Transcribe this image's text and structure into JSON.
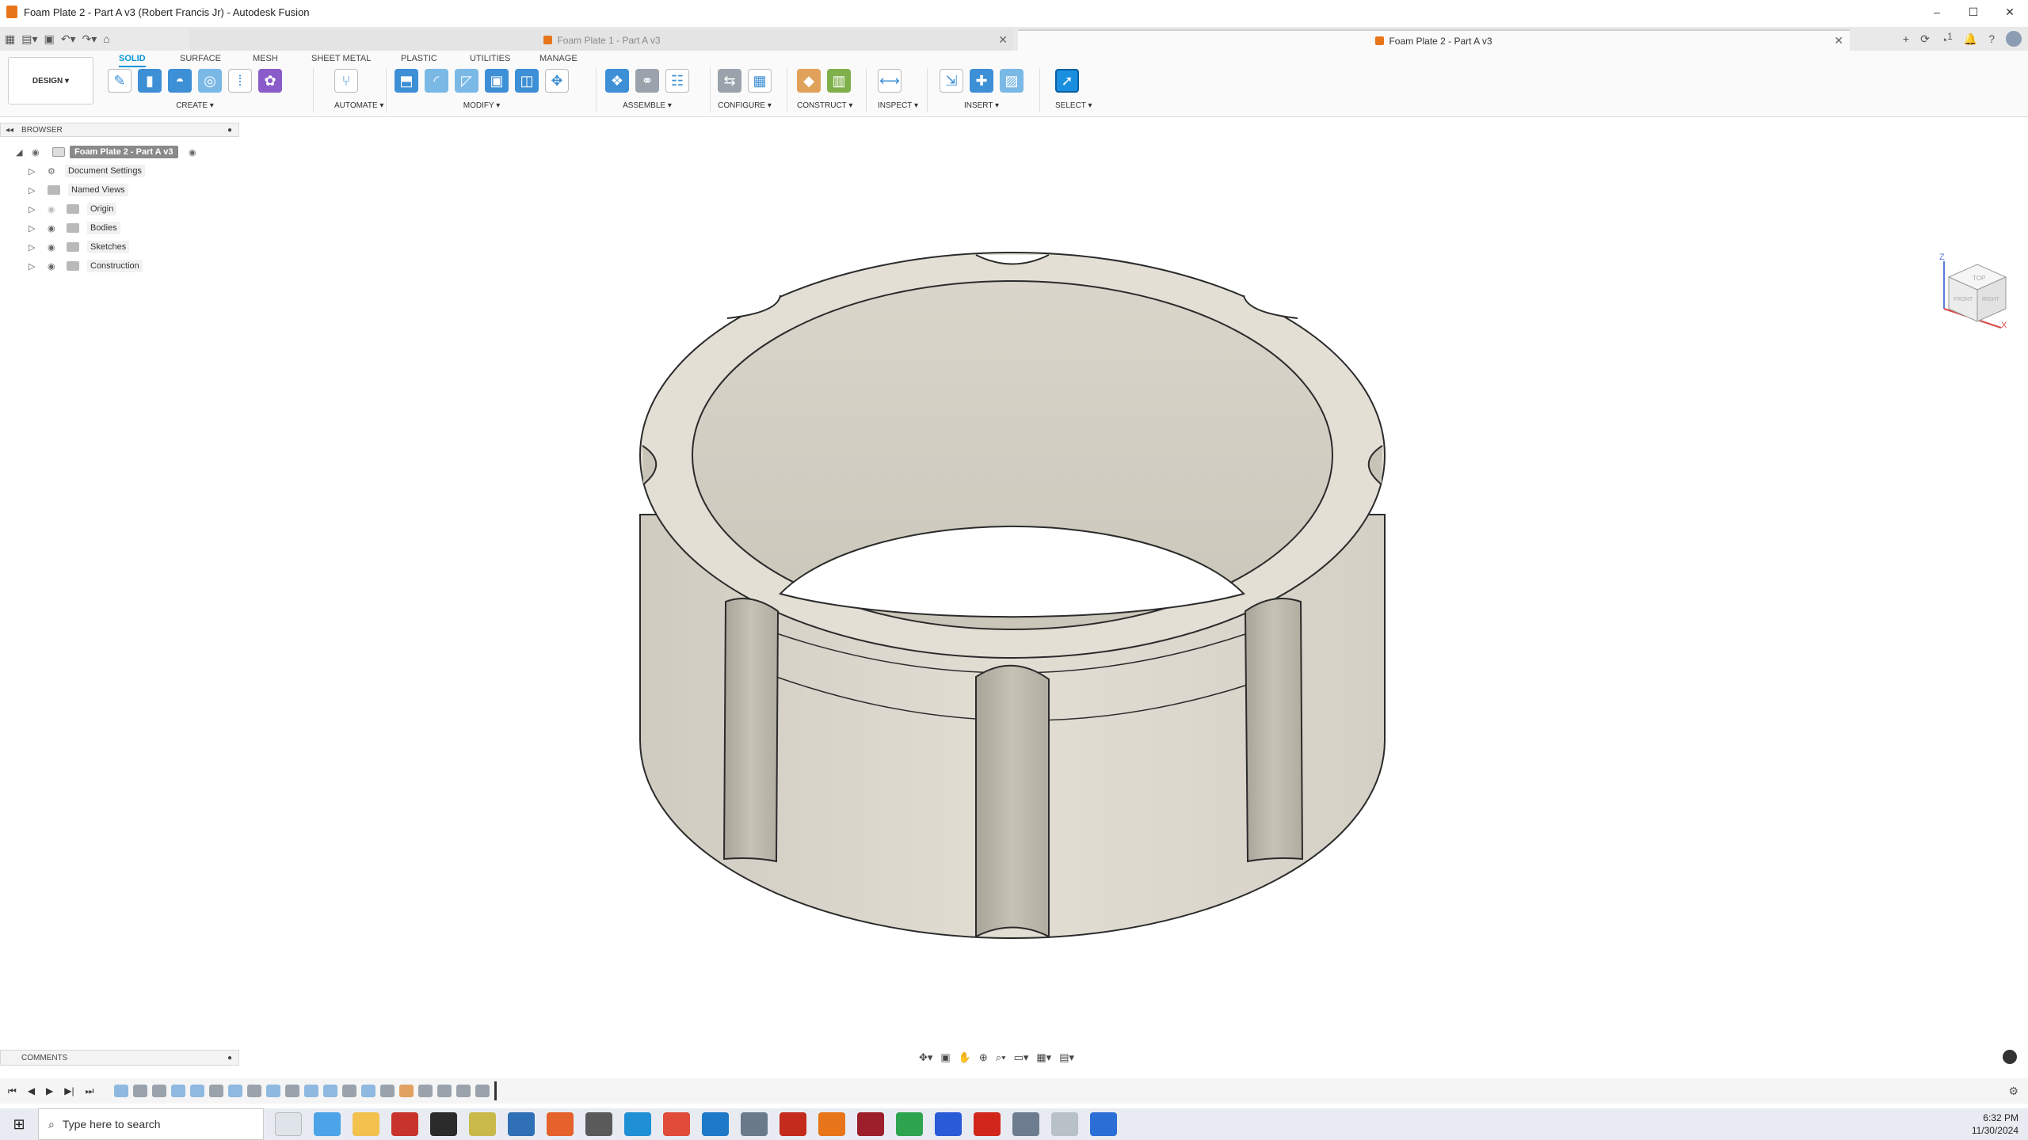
{
  "window": {
    "title": "Foam Plate 2 - Part A v3 (Robert Francis Jr) - Autodesk Fusion",
    "controls": [
      "–",
      "☐",
      "✕"
    ]
  },
  "tabs": [
    {
      "label": "Foam Plate 1 - Part A v3",
      "active": false
    },
    {
      "label": "Foam Plate 2 - Part A v3",
      "active": true
    }
  ],
  "tabbar_icons": {
    "jobs_count": "1"
  },
  "ribbon": {
    "workspace": "DESIGN ▾",
    "tabs": [
      "SOLID",
      "SURFACE",
      "MESH",
      "SHEET METAL",
      "PLASTIC",
      "UTILITIES",
      "MANAGE"
    ],
    "groups": [
      "CREATE ▾",
      "AUTOMATE ▾",
      "MODIFY ▾",
      "ASSEMBLE ▾",
      "CONFIGURE ▾",
      "CONSTRUCT ▾",
      "INSPECT ▾",
      "INSERT ▾",
      "SELECT ▾"
    ]
  },
  "browser": {
    "title": "BROWSER",
    "root": "Foam Plate 2 - Part A v3",
    "items": [
      "Document Settings",
      "Named Views",
      "Origin",
      "Bodies",
      "Sketches",
      "Construction"
    ]
  },
  "viewcube": {
    "labels": [
      "TOP",
      "FRONT",
      "RIGHT"
    ],
    "axes": [
      "Z",
      "X"
    ]
  },
  "comments": {
    "title": "COMMENTS"
  },
  "taskbar": {
    "search_placeholder": "Type here to search",
    "time": "6:32 PM",
    "date": "11/30/2024"
  },
  "colors": {
    "accent": "#0696d7",
    "model_face": "#dcd8ce",
    "model_edge": "#2b2b2b",
    "fusion_orange": "#e8751a"
  }
}
